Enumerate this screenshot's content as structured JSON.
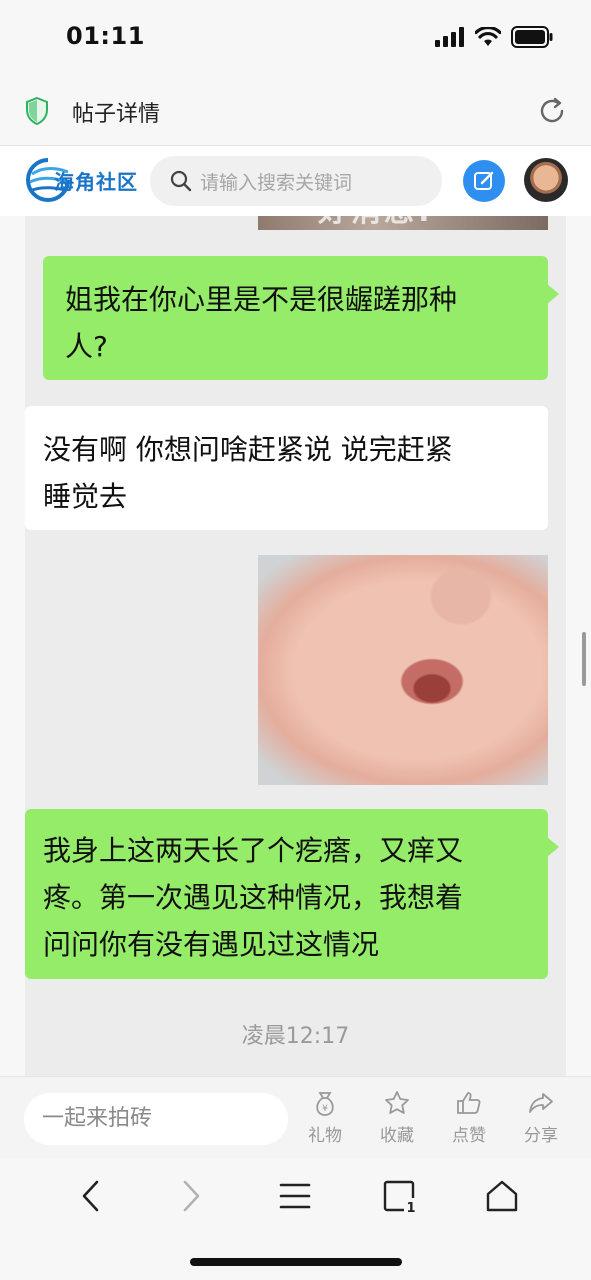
{
  "status_bar": {
    "time": "01:11"
  },
  "browser": {
    "page_title": "帖子详情"
  },
  "site": {
    "logo_text": "海角社区",
    "search_placeholder": "请输入搜索关键词"
  },
  "chat": {
    "messages": [
      {
        "side": "right",
        "text_lines": [
          "姐我在你心里是不是很龌蹉那种",
          "人?"
        ]
      },
      {
        "side": "left",
        "text_lines": [
          "没有啊 你想问啥赶紧说 说完赶紧",
          "睡觉去"
        ]
      },
      {
        "side": "right",
        "text_lines": [
          "我身上这两天长了个疙瘩，又痒又",
          "疼。第一次遇见这种情况，我想着",
          "问问你有没有遇见过这情况"
        ]
      }
    ],
    "image_top_caption": "好消息!",
    "timestamp": "凌晨12:17"
  },
  "comment_bar": {
    "placeholder": "一起来拍砖",
    "actions": [
      {
        "label": "礼物",
        "icon": "gift-bag-icon"
      },
      {
        "label": "收藏",
        "icon": "star-icon"
      },
      {
        "label": "点赞",
        "icon": "thumbs-up-icon"
      },
      {
        "label": "分享",
        "icon": "share-icon"
      }
    ]
  },
  "nav_bar": {
    "tabs_count": "1",
    "icons": [
      "back-icon",
      "forward-icon",
      "menu-icon",
      "tabs-icon",
      "home-icon"
    ]
  },
  "colors": {
    "bubble_green": "#95ec69",
    "accent_blue": "#2f8ff0",
    "logo_blue": "#1a74c8"
  }
}
